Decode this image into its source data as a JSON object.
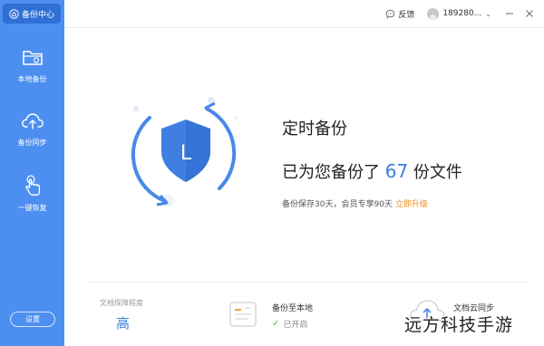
{
  "app": {
    "title": "备份中心"
  },
  "sidebar": {
    "items": [
      {
        "label": "本地备份",
        "icon": "folder-icon"
      },
      {
        "label": "备份同步",
        "icon": "cloud-upload-icon"
      },
      {
        "label": "一键恢复",
        "icon": "hand-tap-icon"
      }
    ],
    "settings_label": "设置"
  },
  "topbar": {
    "feedback_label": "反馈",
    "username": "189280...",
    "chevron": "⌄"
  },
  "main": {
    "headline": "定时备份",
    "count_prefix": "已为您备份了",
    "count_value": "67",
    "count_suffix": "份文件",
    "quota_text": "备份保存30天，会员专享90天",
    "upgrade_label": "立即升级",
    "shield_letter": "L"
  },
  "bottom": {
    "level_label": "文档保障程度",
    "level_value": "高",
    "local_title": "备份至本地",
    "local_status": "已开启",
    "cloud_title": "文档云同步"
  },
  "watermark": "远方科技手游",
  "colors": {
    "sidebar": "#4d8ff0",
    "sidebar_active": "#2f6fd6",
    "accent": "#3b7de0",
    "upgrade": "#f08a1f",
    "check": "#4cb350"
  }
}
